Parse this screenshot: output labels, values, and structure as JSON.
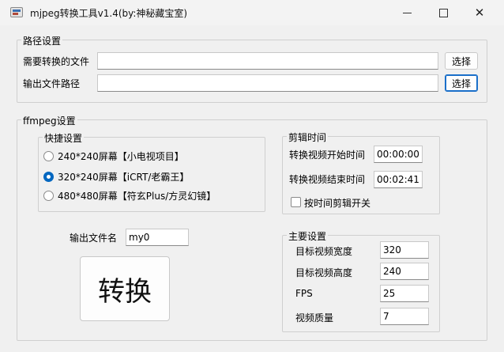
{
  "window": {
    "title": "mjpeg转换工具v1.4(by:神秘藏宝室)",
    "controls": {
      "minimize": "—",
      "maximize": "☐",
      "close": "✕"
    }
  },
  "path_settings": {
    "title": "路径设置",
    "input_label": "需要转换的文件",
    "input_value": "",
    "input_browse": "选择",
    "output_label": "输出文件路径",
    "output_value": "",
    "output_browse": "选择"
  },
  "ffmpeg": {
    "title": "ffmpeg设置",
    "presets": {
      "title": "快捷设置",
      "options": [
        {
          "label": "240*240屏幕【小电视项目】",
          "checked": false
        },
        {
          "label": "320*240屏幕【iCRT/老霸王】",
          "checked": true
        },
        {
          "label": "480*480屏幕【符玄Plus/方灵幻镜】",
          "checked": false
        }
      ]
    },
    "trim": {
      "title": "剪辑时间",
      "start_label": "转换视频开始时间",
      "start_value": "00:00:00",
      "end_label": "转换视频结束时间",
      "end_value": "00:02:41",
      "toggle_label": "按时间剪辑开关",
      "toggle_checked": false
    },
    "output_name": {
      "label": "输出文件名",
      "value": "my0"
    },
    "convert_label": "转换",
    "main": {
      "title": "主要设置",
      "width_label": "目标视频宽度",
      "width_value": "320",
      "height_label": "目标视频高度",
      "height_value": "240",
      "fps_label": "FPS",
      "fps_value": "25",
      "quality_label": "视频质量",
      "quality_value": "7"
    }
  }
}
